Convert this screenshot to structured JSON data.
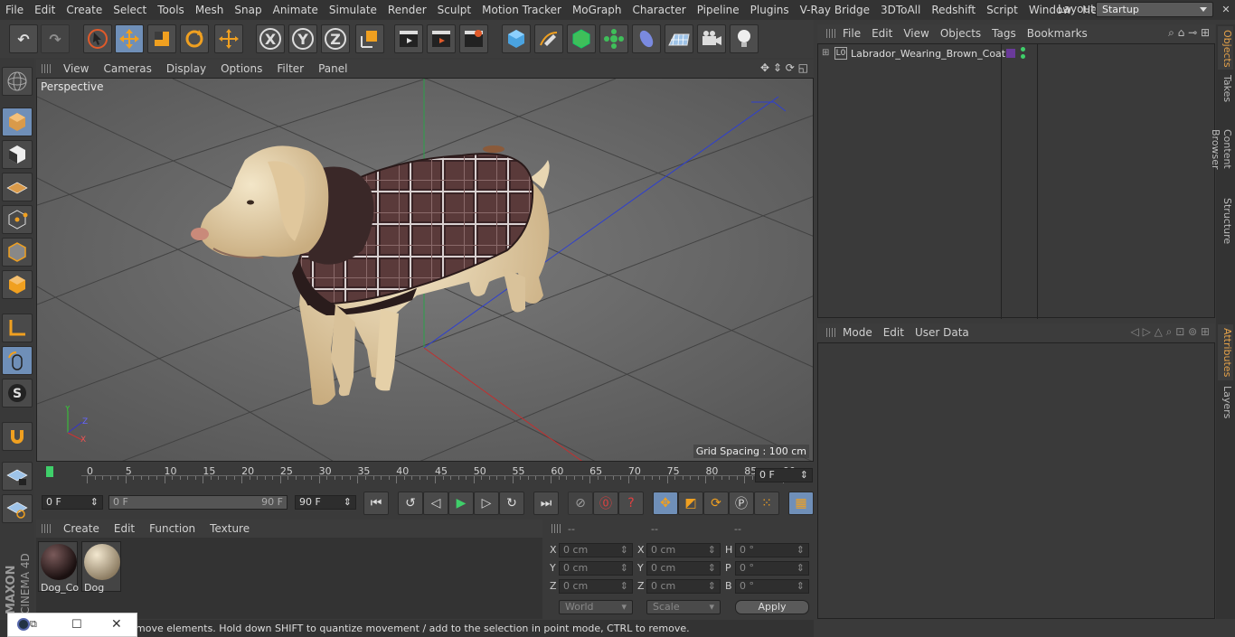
{
  "menu": [
    "File",
    "Edit",
    "Create",
    "Select",
    "Tools",
    "Mesh",
    "Snap",
    "Animate",
    "Simulate",
    "Render",
    "Sculpt",
    "Motion Tracker",
    "MoGraph",
    "Character",
    "Pipeline",
    "Plugins",
    "V-Ray Bridge",
    "3DToAll",
    "Redshift",
    "Script",
    "Window",
    "Help"
  ],
  "layout": {
    "label": "Layout:",
    "value": "Startup"
  },
  "viewport": {
    "menu": [
      "View",
      "Cameras",
      "Display",
      "Options",
      "Filter",
      "Panel"
    ],
    "label": "Perspective",
    "grid_spacing": "Grid Spacing : 100 cm"
  },
  "timeline": {
    "ticks": [
      "0",
      "5",
      "10",
      "15",
      "20",
      "25",
      "30",
      "35",
      "40",
      "45",
      "50",
      "55",
      "60",
      "65",
      "70",
      "75",
      "80",
      "85",
      "90"
    ],
    "current_frame": "0 F",
    "start_field": "0 F",
    "range_start": "0 F",
    "range_end": "90 F",
    "end_field": "90 F"
  },
  "materials": {
    "menu": [
      "Create",
      "Edit",
      "Function",
      "Texture"
    ],
    "items": [
      {
        "name": "Dog_Co"
      },
      {
        "name": "Dog"
      }
    ]
  },
  "coords": {
    "headers": [
      "--",
      "--",
      "--"
    ],
    "rows": [
      {
        "l1": "X",
        "v1": "0 cm",
        "l2": "X",
        "v2": "0 cm",
        "l3": "H",
        "v3": "0 °"
      },
      {
        "l1": "Y",
        "v1": "0 cm",
        "l2": "Y",
        "v2": "0 cm",
        "l3": "P",
        "v3": "0 °"
      },
      {
        "l1": "Z",
        "v1": "0 cm",
        "l2": "Z",
        "v2": "0 cm",
        "l3": "B",
        "v3": "0 °"
      }
    ],
    "mode": "World",
    "scale": "Scale",
    "apply": "Apply"
  },
  "objects": {
    "menu": [
      "File",
      "Edit",
      "View",
      "Objects",
      "Tags",
      "Bookmarks"
    ],
    "items": [
      {
        "name": "Labrador_Wearing_Brown_Coat"
      }
    ]
  },
  "attributes": {
    "menu": [
      "Mode",
      "Edit",
      "User Data"
    ]
  },
  "vtabs": [
    "Objects",
    "Takes",
    "Content Browser",
    "Structure",
    "Attributes",
    "Layers"
  ],
  "status": "move elements. Hold down SHIFT to quantize movement / add to the selection in point mode, CTRL to remove.",
  "brand": {
    "maxon": "MAXON",
    "product": "CINEMA 4D"
  },
  "colors": {
    "accent": "#6f8fb8",
    "tab_active": "#e6a34a",
    "coat": "#5a3a3a",
    "dog": "#e3cfa8"
  }
}
